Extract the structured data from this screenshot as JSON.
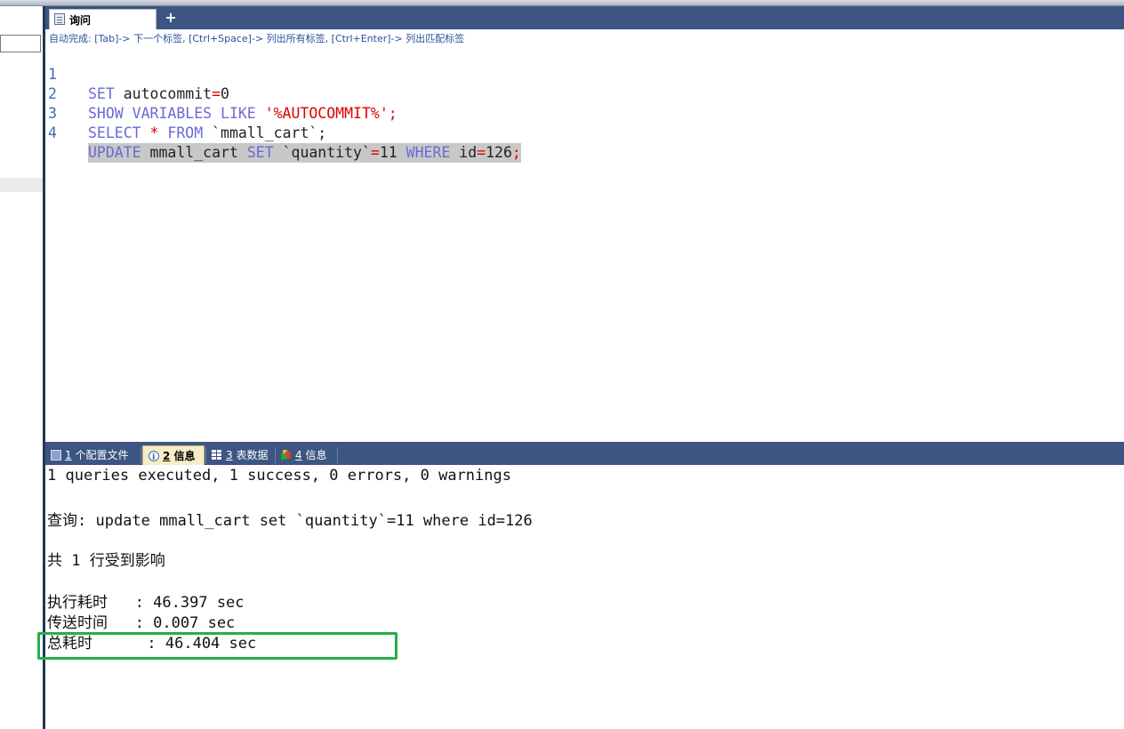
{
  "editor": {
    "tab_label": "询问",
    "add_tab": "+",
    "hint": "自动完成: [Tab]-> 下一个标签, [Ctrl+Space]-> 列出所有标签, [Ctrl+Enter]-> 列出匹配标签",
    "lines": [
      {
        "num": "1"
      },
      {
        "num": "2"
      },
      {
        "num": "3"
      },
      {
        "num": "4"
      }
    ],
    "sql": {
      "l1_kw": "SET",
      "l1_rest": " autocommit",
      "l1_op": "=",
      "l1_val": "0",
      "l2_kw": "SHOW VARIABLES LIKE",
      "l2_sp": " ",
      "l2_str": "'%AUTOCOMMIT%'",
      "l2_end": ";",
      "l3_kw": "SELECT",
      "l3_star": " * ",
      "l3_from": "FROM",
      "l3_rest": " `mmall_cart`;",
      "l4_kw1": "UPDATE",
      "l4_t": " mmall_cart ",
      "l4_kw2": "SET",
      "l4_col": " `quantity`",
      "l4_op1": "=",
      "l4_v1": "11 ",
      "l4_kw3": "WHERE",
      "l4_id": " id",
      "l4_op2": "=",
      "l4_v2": "126",
      "l4_end": ";"
    }
  },
  "results": {
    "tabs": [
      {
        "num": "1",
        "label": " 个配置文件"
      },
      {
        "num": "2",
        "label": " 信息"
      },
      {
        "num": "3",
        "label": " 表数据"
      },
      {
        "num": "4",
        "label": " 信息"
      }
    ],
    "active_tab": 1,
    "messages": {
      "summary": "1 queries executed, 1 success, 0 errors, 0 warnings",
      "query": "查询: update mmall_cart set `quantity`=11 where id=126",
      "affected": "共 1 行受到影响",
      "exec_time": "执行耗时   : 46.397 sec",
      "transfer_time": "传送时间   : 0.007 sec",
      "total_time": "总耗时      : 46.404 sec"
    }
  }
}
